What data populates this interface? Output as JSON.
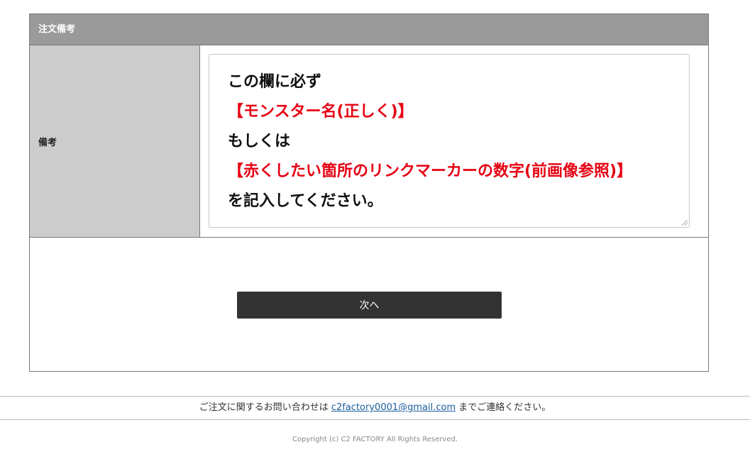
{
  "section": {
    "header_title": "注文備考",
    "row_label": "備考"
  },
  "note": {
    "lines": [
      {
        "text": "この欄に必ず",
        "color": "#111111"
      },
      {
        "text": "【モンスター名(正しく)】",
        "color": "#e60012"
      },
      {
        "text": "もしくは",
        "color": "#111111"
      },
      {
        "text": "【赤くしたい箇所のリンクマーカーの数字(前画像参照)】",
        "color": "#e60012"
      },
      {
        "text": "を記入してください。",
        "color": "#111111"
      }
    ]
  },
  "actions": {
    "next_label": "次へ"
  },
  "footer": {
    "contact_prefix": "ご注文に関するお問い合わせは",
    "contact_email": "c2factory0001@gmail.com",
    "contact_suffix": "までご連絡ください。",
    "copyright": "Copyright (c) C2 FACTORY All Rights Reserved."
  },
  "colors": {
    "header_bg": "#9a9a9a",
    "label_bg": "#cccccc",
    "accent_red": "#e60012",
    "button_bg": "#333333"
  }
}
